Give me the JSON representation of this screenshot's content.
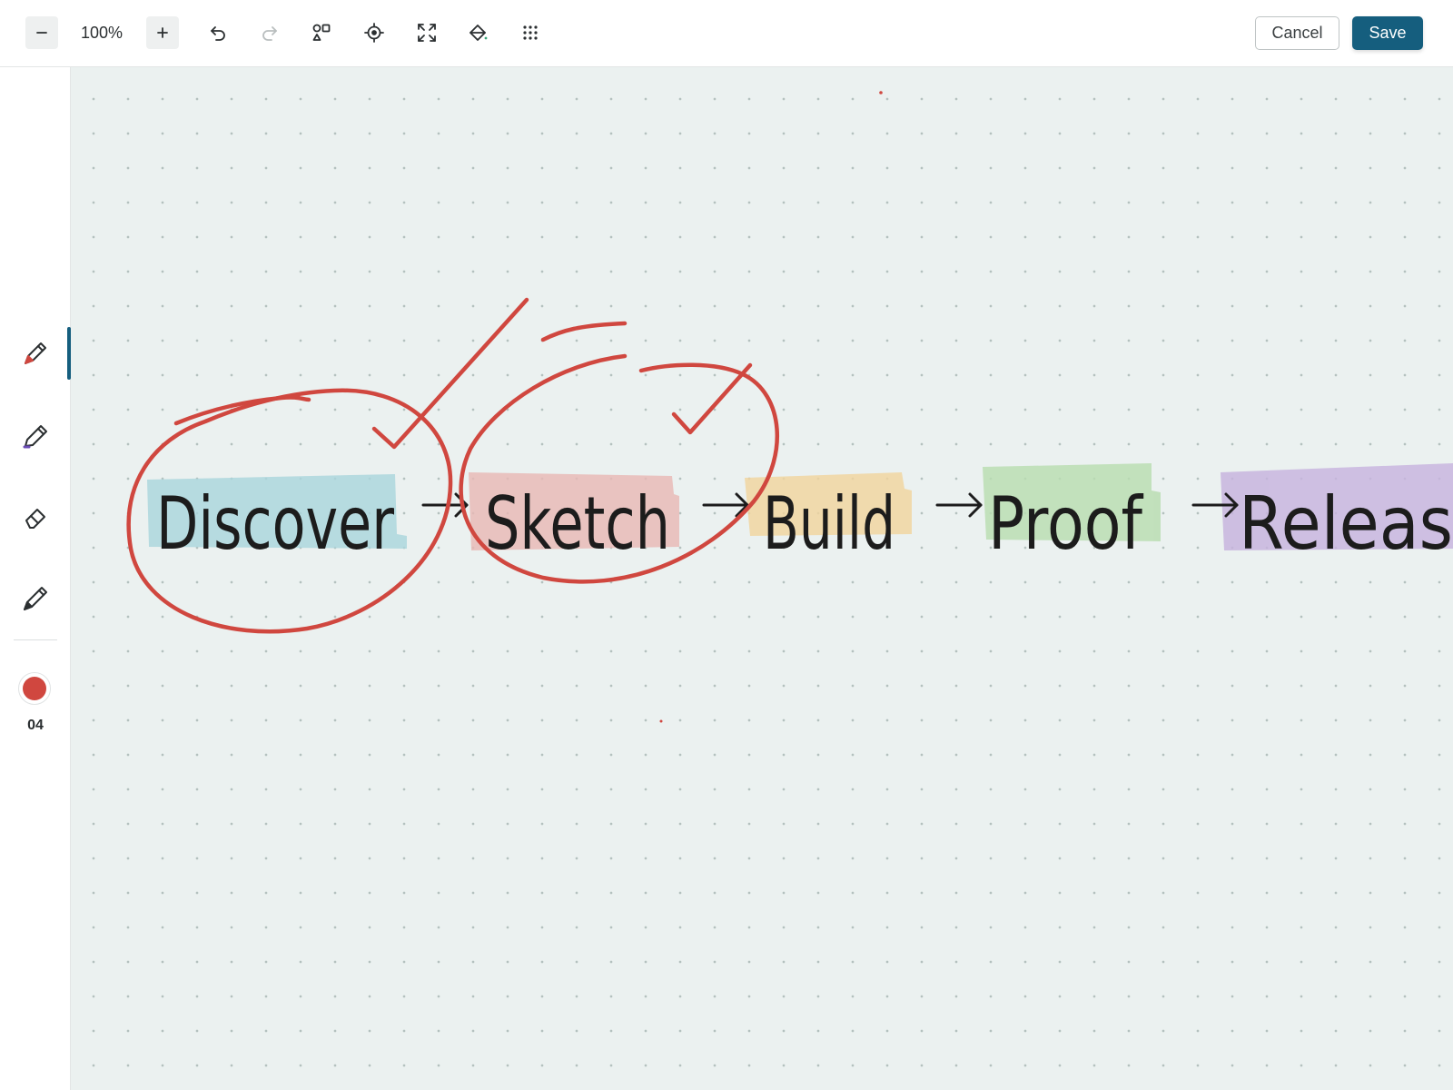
{
  "toolbar": {
    "zoom_level": "100%",
    "zoom_out_icon": "minus-icon",
    "zoom_in_icon": "plus-icon",
    "undo_icon": "undo-icon",
    "redo_icon": "redo-icon",
    "shapes_icon": "shapes-icon",
    "locate_icon": "crosshair-icon",
    "fit_icon": "expand-icon",
    "fill_icon": "paint-bucket-icon",
    "grid_icon": "grid-dots-icon",
    "cancel_label": "Cancel",
    "save_label": "Save"
  },
  "tools": [
    {
      "name": "pen",
      "icon": "pen-icon",
      "active": true
    },
    {
      "name": "marker",
      "icon": "marker-icon",
      "active": false
    },
    {
      "name": "eraser",
      "icon": "eraser-icon",
      "active": false
    },
    {
      "name": "pencil",
      "icon": "pencil-icon",
      "active": false
    }
  ],
  "color": {
    "value": "#d0473f"
  },
  "stroke_size": "04",
  "canvas": {
    "words": [
      {
        "text": "Discover",
        "highlight": "#a9d6dc"
      },
      {
        "text": "Sketch",
        "highlight": "#e8b8b4"
      },
      {
        "text": "Build",
        "highlight": "#f0d49e"
      },
      {
        "text": "Proof",
        "highlight": "#b8ddb0"
      },
      {
        "text": "Releas",
        "highlight": "#c7b3de"
      }
    ],
    "arrow": "→",
    "ink_color": "#d0473f"
  }
}
